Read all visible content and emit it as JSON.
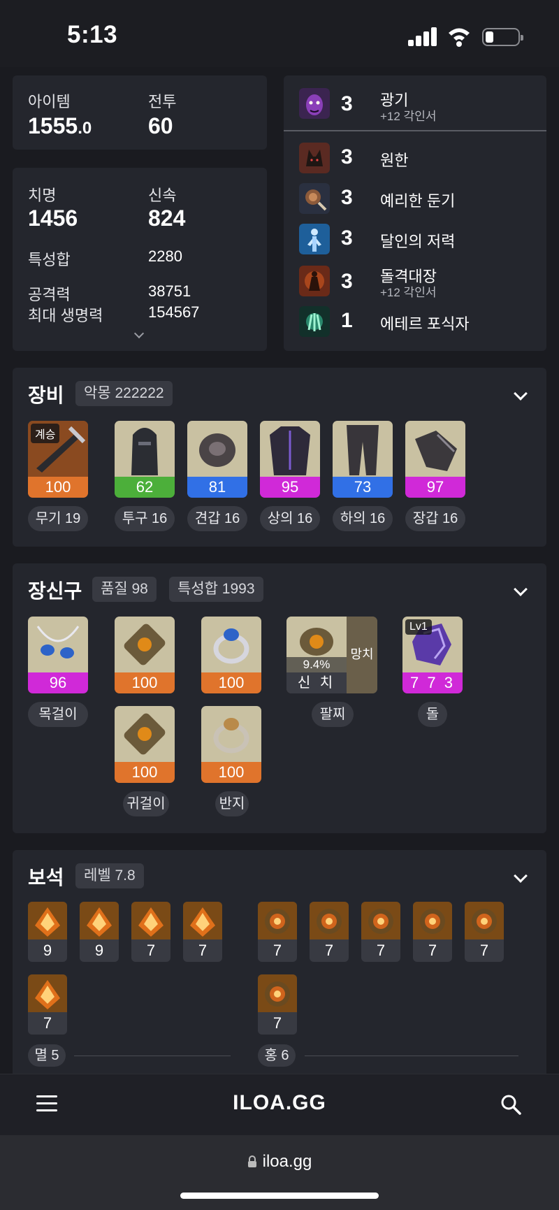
{
  "status": {
    "time": "5:13"
  },
  "stats": {
    "item_label": "아이템",
    "item_value_main": "1555",
    "item_value_dec": ".0",
    "combat_label": "전투",
    "combat_value": "60",
    "crit_label": "치명",
    "crit_value": "1456",
    "swift_label": "신속",
    "swift_value": "824",
    "trait_sum_label": "특성합",
    "trait_sum_value": "2280",
    "atk_label": "공격력",
    "atk_value": "38751",
    "hp_label": "최대 생명력",
    "hp_value": "154567"
  },
  "engravings": [
    {
      "level": "3",
      "name": "광기",
      "sub": "+12 각인서",
      "icon": "demon-face-icon"
    },
    {
      "level": "3",
      "name": "원한",
      "sub": "",
      "icon": "wolf-head-icon"
    },
    {
      "level": "3",
      "name": "예리한 둔기",
      "sub": "",
      "icon": "mace-icon"
    },
    {
      "level": "3",
      "name": "달인의 저력",
      "sub": "",
      "icon": "glowing-figure-icon"
    },
    {
      "level": "3",
      "name": "돌격대장",
      "sub": "+12 각인서",
      "icon": "charging-warrior-icon"
    },
    {
      "level": "1",
      "name": "에테르 포식자",
      "sub": "",
      "icon": "green-claw-icon"
    }
  ],
  "equipment": {
    "title": "장비",
    "set_pill": "악몽 222222",
    "items": [
      {
        "badge": "계승",
        "quality": "100",
        "label": "무기 19",
        "color": "#e0742c"
      },
      {
        "badge": "",
        "quality": "62",
        "label": "투구 16",
        "color": "#4caf3a"
      },
      {
        "badge": "",
        "quality": "81",
        "label": "견갑 16",
        "color": "#3170e6"
      },
      {
        "badge": "",
        "quality": "95",
        "label": "상의 16",
        "color": "#d029d8"
      },
      {
        "badge": "",
        "quality": "73",
        "label": "하의 16",
        "color": "#3170e6"
      },
      {
        "badge": "",
        "quality": "97",
        "label": "장갑 16",
        "color": "#d029d8"
      }
    ]
  },
  "accessories": {
    "title": "장신구",
    "quality_pill": "품질 98",
    "trait_pill": "특성합 1993",
    "necklace": {
      "quality": "96",
      "label": "목걸이",
      "color": "#d029d8"
    },
    "earring1": {
      "quality": "100",
      "color": "#e0742c"
    },
    "earring2": {
      "quality": "100",
      "label": "귀걸이",
      "color": "#e0742c"
    },
    "ring1": {
      "quality": "100",
      "color": "#e0742c"
    },
    "ring2": {
      "quality": "100",
      "label": "반지",
      "color": "#e0742c"
    },
    "bracelet": {
      "percent": "9.4%",
      "stats": "신 치",
      "side": "망치",
      "label": "팔찌"
    },
    "stone": {
      "badge": "Lv1",
      "value": "7 7 3",
      "label": "돌",
      "color": "#d029d8"
    }
  },
  "gems": {
    "title": "보석",
    "level_pill": "레벨 7.8",
    "left": [
      "9",
      "9",
      "7",
      "7",
      "7"
    ],
    "right": [
      "7",
      "7",
      "7",
      "7",
      "7",
      "7"
    ],
    "left_label": "멸 5",
    "right_label": "홍 6"
  },
  "nav": {
    "brand": "ILOA.GG",
    "url": "iloa.gg"
  }
}
